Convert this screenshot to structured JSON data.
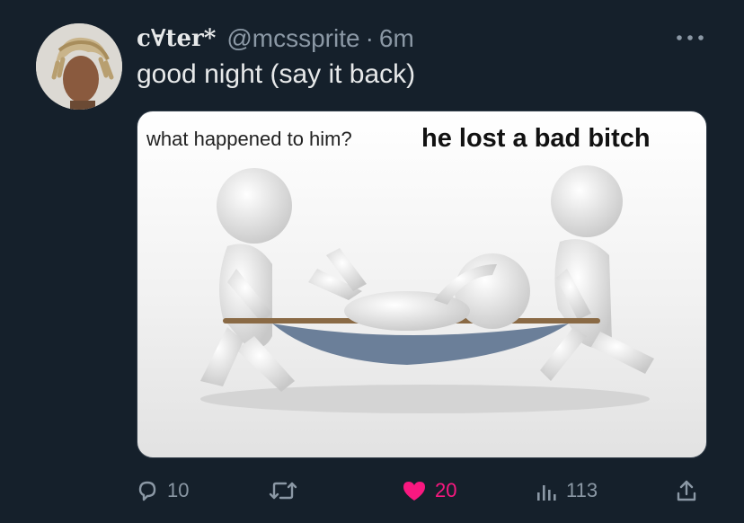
{
  "author": {
    "display_name": "c∀ter*",
    "handle": "@mcssprite",
    "separator": "·",
    "time": "6m"
  },
  "tweet": {
    "text": "good night (say it back)"
  },
  "media": {
    "caption_left": "what happened to him?",
    "caption_right": "he lost a bad bitch"
  },
  "actions": {
    "replies": "10",
    "likes": "20",
    "views": "113"
  },
  "colors": {
    "background": "#15202b",
    "like_active": "#f91880",
    "secondary_text": "#8b98a5"
  },
  "icons": {
    "reply": "reply-icon",
    "retweet": "retweet-icon",
    "like": "heart-icon",
    "views": "views-icon",
    "share": "share-icon",
    "more": "more-icon"
  }
}
